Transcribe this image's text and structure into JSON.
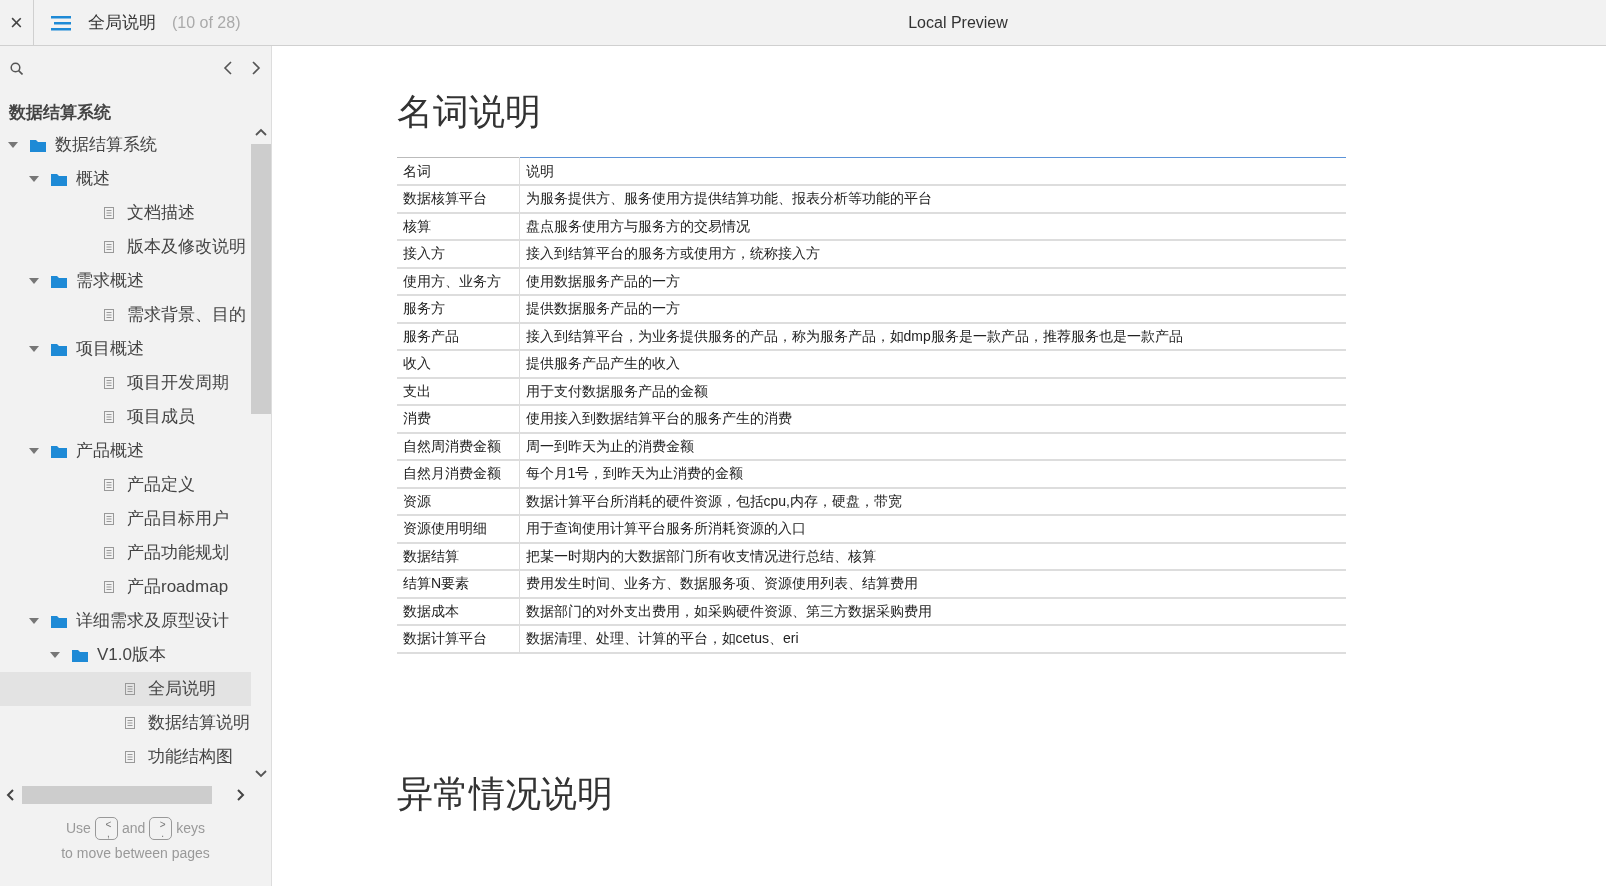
{
  "topbar": {
    "close": "×",
    "title": "全局说明",
    "counter": "(10 of 28)",
    "center_title": "Local Preview"
  },
  "sidebar": {
    "title": "数据结算系统",
    "tree": [
      {
        "label": "数据结算系统",
        "kind": "folder",
        "expanded": true,
        "selected": false,
        "children": [
          {
            "label": "概述",
            "kind": "folder",
            "expanded": true,
            "selected": false,
            "children": [
              {
                "label": "文档描述",
                "kind": "page",
                "selected": false
              },
              {
                "label": "版本及修改说明",
                "kind": "page",
                "selected": false
              }
            ]
          },
          {
            "label": "需求概述",
            "kind": "folder",
            "expanded": true,
            "selected": false,
            "children": [
              {
                "label": "需求背景、目的",
                "kind": "page",
                "selected": false
              }
            ]
          },
          {
            "label": "项目概述",
            "kind": "folder",
            "expanded": true,
            "selected": false,
            "children": [
              {
                "label": "项目开发周期",
                "kind": "page",
                "selected": false
              },
              {
                "label": "项目成员",
                "kind": "page",
                "selected": false
              }
            ]
          },
          {
            "label": "产品概述",
            "kind": "folder",
            "expanded": true,
            "selected": false,
            "children": [
              {
                "label": "产品定义",
                "kind": "page",
                "selected": false
              },
              {
                "label": "产品目标用户",
                "kind": "page",
                "selected": false
              },
              {
                "label": "产品功能规划",
                "kind": "page",
                "selected": false
              },
              {
                "label": "产品roadmap",
                "kind": "page",
                "selected": false
              }
            ]
          },
          {
            "label": "详细需求及原型设计",
            "kind": "folder",
            "expanded": true,
            "selected": false,
            "children": [
              {
                "label": "V1.0版本",
                "kind": "folder",
                "expanded": true,
                "selected": false,
                "children": [
                  {
                    "label": "全局说明",
                    "kind": "page",
                    "selected": true
                  },
                  {
                    "label": "数据结算说明",
                    "kind": "page",
                    "selected": false
                  },
                  {
                    "label": "功能结构图",
                    "kind": "page",
                    "selected": false
                  }
                ]
              }
            ]
          }
        ]
      }
    ],
    "hint": {
      "prefix": "Use",
      "key_prev": [
        "<",
        ","
      ],
      "middle": "and",
      "key_next": [
        ">",
        "."
      ],
      "suffix": "keys",
      "line2": "to move between pages"
    }
  },
  "content": {
    "heading": "名词说明",
    "table": {
      "columns": [
        "名词",
        "说明"
      ],
      "rows": [
        [
          "数据核算平台",
          "为服务提供方、服务使用方提供结算功能、报表分析等功能的平台"
        ],
        [
          "核算",
          "盘点服务使用方与服务方的交易情况"
        ],
        [
          "接入方",
          "接入到结算平台的服务方或使用方，统称接入方"
        ],
        [
          "使用方、业务方",
          "使用数据服务产品的一方"
        ],
        [
          "服务方",
          "提供数据服务产品的一方"
        ],
        [
          "服务产品",
          "接入到结算平台，为业务提供服务的产品，称为服务产品，如dmp服务是一款产品，推荐服务也是一款产品"
        ],
        [
          "收入",
          "提供服务产品产生的收入"
        ],
        [
          "支出",
          "用于支付数据服务产品的金额"
        ],
        [
          "消费",
          "使用接入到数据结算平台的服务产生的消费"
        ],
        [
          "自然周消费金额",
          "周一到昨天为止的消费金额"
        ],
        [
          "自然月消费金额",
          "每个月1号，到昨天为止消费的金额"
        ],
        [
          "资源",
          "数据计算平台所消耗的硬件资源，包括cpu,内存，硬盘，带宽"
        ],
        [
          "资源使用明细",
          "用于查询使用计算平台服务所消耗资源的入口"
        ],
        [
          "数据结算",
          "把某一时期内的大数据部门所有收支情况进行总结、核算"
        ],
        [
          "结算N要素",
          "费用发生时间、业务方、数据服务项、资源使用列表、结算费用"
        ],
        [
          "数据成本",
          "数据部门的对外支出费用，如采购硬件资源、第三方数据采购费用"
        ],
        [
          "数据计算平台",
          "数据清理、处理、计算的平台，如cetus、eri"
        ]
      ]
    },
    "heading2": "异常情况说明"
  }
}
